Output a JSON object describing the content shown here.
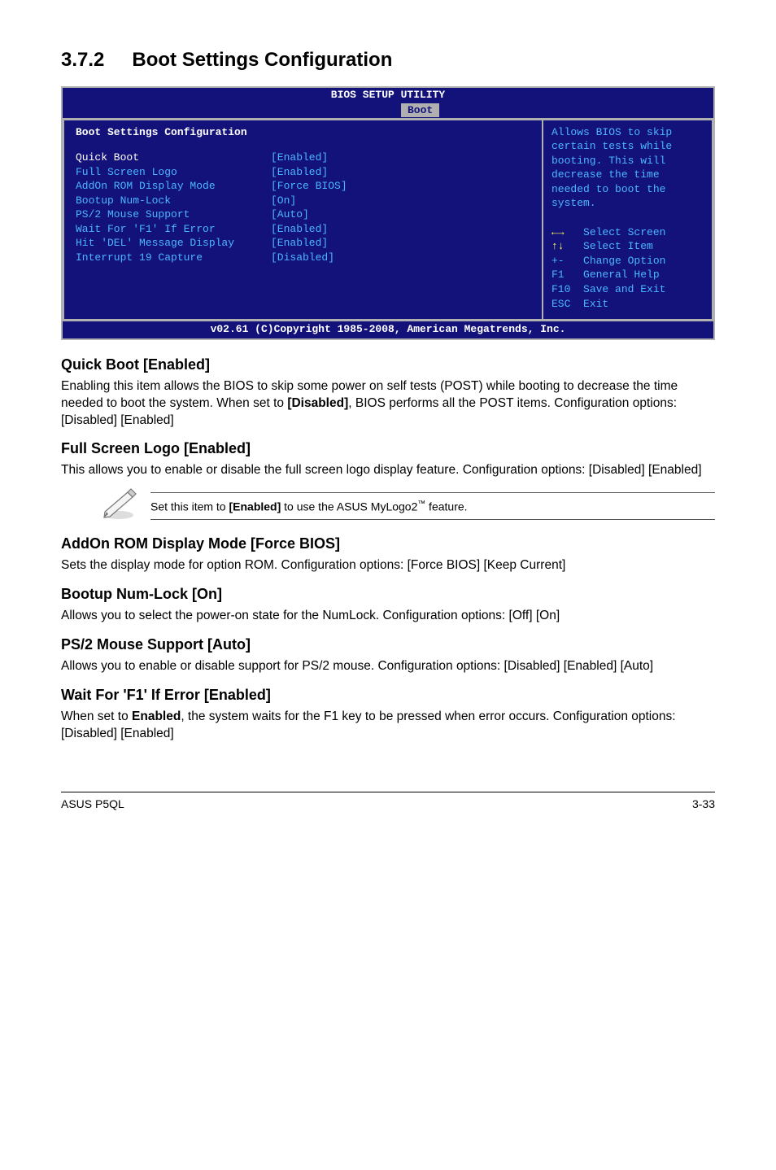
{
  "section": {
    "number": "3.7.2",
    "title": "Boot Settings Configuration"
  },
  "bios": {
    "utility_title": "BIOS SETUP UTILITY",
    "tab": "Boot",
    "panel_title": "Boot Settings Configuration",
    "items": [
      {
        "label": "Quick Boot",
        "value": "[Enabled]",
        "hl": true
      },
      {
        "label": "Full Screen Logo",
        "value": "[Enabled]",
        "hl": false
      },
      {
        "label": "AddOn ROM Display Mode",
        "value": "[Force BIOS]",
        "hl": false
      },
      {
        "label": "Bootup Num-Lock",
        "value": "[On]",
        "hl": false
      },
      {
        "label": "PS/2 Mouse Support",
        "value": "[Auto]",
        "hl": false
      },
      {
        "label": "Wait For 'F1' If Error",
        "value": "[Enabled]",
        "hl": false
      },
      {
        "label": "Hit 'DEL' Message Display",
        "value": "[Enabled]",
        "hl": false
      },
      {
        "label": "Interrupt 19 Capture",
        "value": "[Disabled]",
        "hl": false
      }
    ],
    "help_text": "Allows BIOS to skip certain tests while booting. This will decrease the time needed to boot the system.",
    "keys": [
      {
        "k": "←→",
        "d": "Select Screen",
        "arrow": true
      },
      {
        "k": "↑↓",
        "d": "Select Item",
        "arrow": true
      },
      {
        "k": "+-",
        "d": "Change Option",
        "arrow": false
      },
      {
        "k": "F1",
        "d": "General Help",
        "arrow": false
      },
      {
        "k": "F10",
        "d": "Save and Exit",
        "arrow": false
      },
      {
        "k": "ESC",
        "d": "Exit",
        "arrow": false
      }
    ],
    "footer": "v02.61 (C)Copyright 1985-2008, American Megatrends, Inc."
  },
  "sections": {
    "quick_boot": {
      "heading": "Quick Boot [Enabled]",
      "p1a": "Enabling this item allows the BIOS to skip some power on self tests (POST) while booting to decrease the time needed to boot the system. When set to ",
      "p1b": "[Disabled]",
      "p1c": ", BIOS performs all the POST items. Configuration options: [Disabled] [Enabled]"
    },
    "full_screen": {
      "heading": "Full Screen Logo [Enabled]",
      "p1": "This allows you to enable or disable the full screen logo display feature. Configuration options: [Disabled] [Enabled]"
    },
    "note": {
      "a": "Set this item to ",
      "b": "[Enabled]",
      "c": " to use the ASUS MyLogo2",
      "d": " feature."
    },
    "addon": {
      "heading": "AddOn ROM Display Mode [Force BIOS]",
      "p1": "Sets the display mode for option ROM. Configuration options: [Force BIOS] [Keep Current]"
    },
    "numlock": {
      "heading": "Bootup Num-Lock [On]",
      "p1": "Allows you to select the power-on state for the NumLock. Configuration options: [Off] [On]"
    },
    "ps2": {
      "heading": "PS/2 Mouse Support [Auto]",
      "p1": "Allows you to enable or disable support for PS/2 mouse. Configuration options: [Disabled] [Enabled] [Auto]"
    },
    "waitf1": {
      "heading": "Wait For 'F1' If Error [Enabled]",
      "p1a": "When set to ",
      "p1b": "Enabled",
      "p1c": ", the system waits for the F1 key to be pressed when error occurs. Configuration options: [Disabled] [Enabled]"
    }
  },
  "footer": {
    "left": "ASUS P5QL",
    "right": "3-33"
  }
}
